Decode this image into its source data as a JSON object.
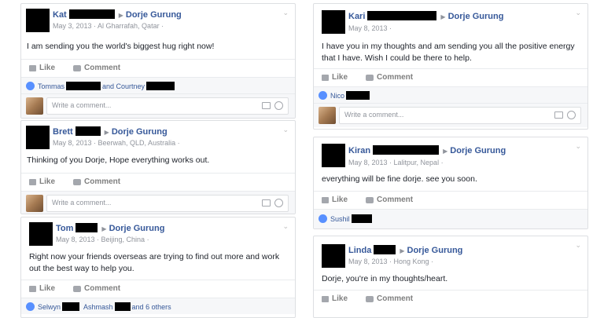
{
  "common": {
    "target": "Dorje Gurung",
    "like": "Like",
    "comment": "Comment",
    "comment_placeholder": "Write a comment..."
  },
  "posts": [
    {
      "name": "Kat",
      "meta": "May 3, 2013 · Al Gharrafah, Qatar ·",
      "body": "I am sending you the world's biggest hug right now!",
      "likes": [
        "Tommas",
        "and Courtney"
      ]
    },
    {
      "name": "Brett",
      "meta": "May 8, 2013 · Beerwah, QLD, Australia ·",
      "body": "Thinking of you Dorje, Hope everything works out."
    },
    {
      "name": "Tom",
      "meta": "May 8, 2013 · Beijing, China ·",
      "body": "Right now your friends overseas are trying to find out more and work out the best way to help you.",
      "likes": [
        "Selwyn",
        "Ashmash",
        "and 6 others"
      ]
    },
    {
      "name": "Kari",
      "meta": "May 8, 2013 ·",
      "body": "I have you in my thoughts and am sending you all the positive energy that I have. Wish I could be there to help.",
      "likes": [
        "Nico"
      ]
    },
    {
      "name": "Kiran",
      "meta": "May 8, 2013 · Lalitpur, Nepal ·",
      "body": "everything will be fine dorje. see you soon.",
      "likes": [
        "Sushil"
      ]
    },
    {
      "name": "Linda",
      "meta": "May 8, 2013 · Hong Kong ·",
      "body": "Dorje, you're in my thoughts/heart."
    }
  ]
}
